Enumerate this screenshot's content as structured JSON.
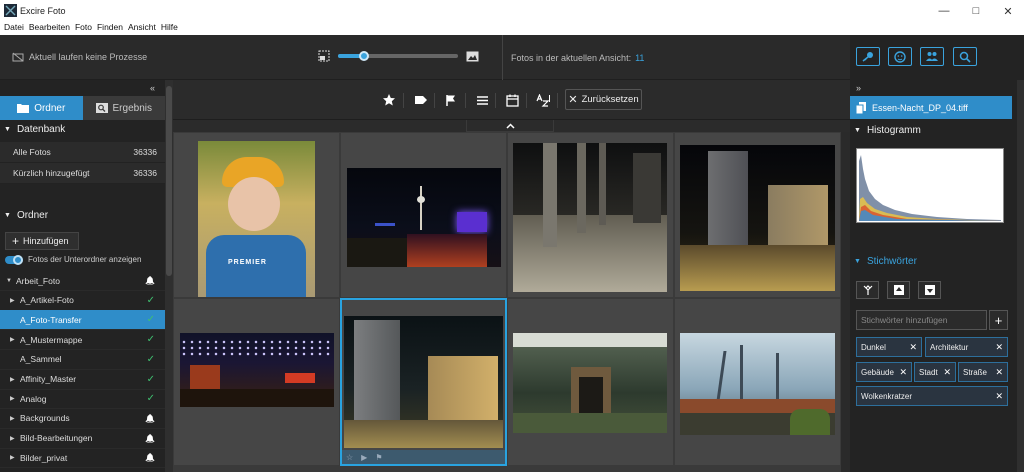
{
  "window": {
    "title": "Excire Foto"
  },
  "menu": [
    "Datei",
    "Bearbeiten",
    "Foto",
    "Finden",
    "Ansicht",
    "Hilfe"
  ],
  "topbar": {
    "status": "Aktuell laufen keine Prozesse",
    "count_label": "Fotos in der aktuellen Ansicht:",
    "count_value": "11",
    "zoom_level": 0.22
  },
  "left": {
    "tabs": [
      {
        "label": "Ordner"
      },
      {
        "label": "Ergebnis"
      }
    ],
    "database": {
      "heading": "Datenbank",
      "rows": [
        {
          "label": "Alle Fotos",
          "count": "36336"
        },
        {
          "label": "Kürzlich hinzugefügt",
          "count": "36336"
        }
      ]
    },
    "folders": {
      "heading": "Ordner",
      "add_label": "Hinzufügen",
      "subfolders_label": "Fotos der Unterordner anzeigen",
      "items": [
        {
          "name": "Arbeit_Foto",
          "level": 0,
          "arrow": "down",
          "status": "bell"
        },
        {
          "name": "A_Artikel-Foto",
          "level": 1,
          "arrow": "right",
          "status": "check"
        },
        {
          "name": "A_Foto-Transfer",
          "level": 1,
          "arrow": "",
          "status": "check",
          "selected": true
        },
        {
          "name": "A_Mustermappe",
          "level": 1,
          "arrow": "right",
          "status": "check"
        },
        {
          "name": "A_Sammel",
          "level": 1,
          "arrow": "",
          "status": "check"
        },
        {
          "name": "Affinity_Master",
          "level": 1,
          "arrow": "right",
          "status": "check"
        },
        {
          "name": "Analog",
          "level": 1,
          "arrow": "right",
          "status": "check"
        },
        {
          "name": "Backgrounds",
          "level": 1,
          "arrow": "right",
          "status": "bell"
        },
        {
          "name": "Bild-Bearbeitungen",
          "level": 1,
          "arrow": "right",
          "status": "bell"
        },
        {
          "name": "Bilder_privat",
          "level": 1,
          "arrow": "right",
          "status": "bell"
        }
      ]
    }
  },
  "toolbar": {
    "reset_label": "Zurücksetzen"
  },
  "right": {
    "file_name": "Essen-Nacht_DP_04.tiff",
    "histogram_heading": "Histogramm",
    "keywords_heading": "Stichwörter",
    "keyword_placeholder": "Stichwörter hinzufügen",
    "keywords": [
      "Dunkel",
      "Architektur",
      "Gebäude",
      "Stadt",
      "Straße",
      "Wolkenkratzer"
    ]
  },
  "photos": [
    {
      "name": "photo-child-with-cap"
    },
    {
      "name": "photo-berlin-tv-tower-night"
    },
    {
      "name": "photo-colonnade-night"
    },
    {
      "name": "photo-skyscraper-street-night"
    },
    {
      "name": "photo-market-lights-night"
    },
    {
      "name": "photo-essen-night",
      "selected": true
    },
    {
      "name": "photo-industrial-hall"
    },
    {
      "name": "photo-harbor-cranes"
    }
  ],
  "colors": {
    "accent": "#2f8dc9",
    "check": "#3fbf6f"
  }
}
